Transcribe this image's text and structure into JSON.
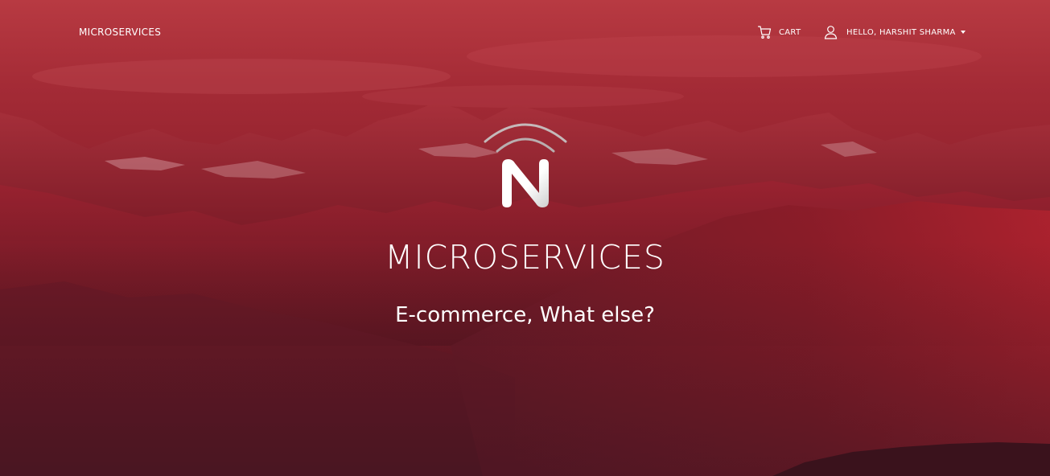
{
  "navbar": {
    "brand": "MICROSERVICES",
    "cart_label": "CART",
    "user_label": "HELLO, HARSHIT SHARMA"
  },
  "hero": {
    "title": "MICROSERVICES",
    "subtitle": "E-commerce, What else?"
  },
  "icons": {
    "cart": "cart-icon",
    "user": "user-icon",
    "dropdown": "caret-down-icon",
    "logo": "n-logo"
  },
  "colors": {
    "overlay_top": "#b83a42",
    "overlay_mid": "#8c1f2b",
    "overlay_bottom": "#3e1420",
    "text": "#ffffff"
  }
}
